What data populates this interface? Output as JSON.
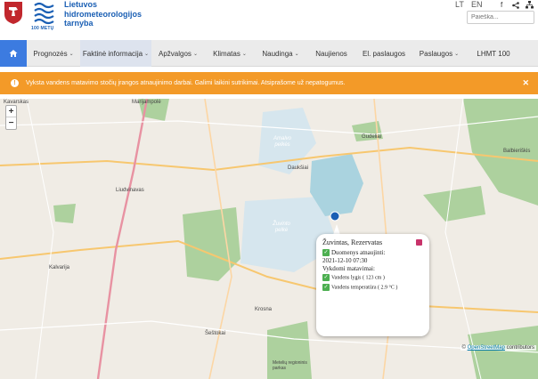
{
  "header": {
    "site_name_lines": [
      "Lietuvos",
      "hidrometeorologijos",
      "tarnyba"
    ],
    "anniversary": "100 METŲ",
    "lang_lt": "LT",
    "lang_en": "EN",
    "search_placeholder": "Paieška..."
  },
  "nav": {
    "items": [
      {
        "label": "Prognozės",
        "dropdown": true
      },
      {
        "label": "Faktinė informacija",
        "dropdown": true,
        "active": true
      },
      {
        "label": "Apžvalgos",
        "dropdown": true
      },
      {
        "label": "Klimatas",
        "dropdown": true
      },
      {
        "label": "Naudinga",
        "dropdown": true
      },
      {
        "label": "Naujienos",
        "dropdown": false
      },
      {
        "label": "El. paslaugos",
        "dropdown": false
      },
      {
        "label": "Paslaugos",
        "dropdown": true
      },
      {
        "label": "LHMT 100",
        "dropdown": false
      }
    ]
  },
  "alert": {
    "text": "Vyksta vandens matavimo stočių įrangos atnaujinimo darbai. Galimi laikini sutrikimai. Atsiprašome už nepatogumus.",
    "color": "#f39a28"
  },
  "map": {
    "towns": [
      "Marijampolė",
      "Liudvinavas",
      "Daukšiai",
      "Gudeliai",
      "Balbieriškis",
      "Kalvarija",
      "Krosna",
      "Šeštokai",
      "Metelių regioninis parkas",
      "Kavarskas"
    ],
    "lake_labels": [
      "Amalvo pelkės",
      "Žuvinto pelkė"
    ],
    "popup": {
      "title": "Žuvintas, Rezervatas",
      "updated_label": "Duomenys atnaujinti:",
      "updated_value": "2021-12-10 07:30",
      "measurements_label": "Vykdomi matavimai:",
      "measurements": [
        {
          "label": "Vandens lygis ( 123 cm )"
        },
        {
          "label": "Vandens temperatūra ( 2.9 °C )"
        }
      ]
    },
    "attribution_prefix": "©",
    "attribution_link": "OpenStreetMap",
    "attribution_suffix": "contributors"
  },
  "colors": {
    "nav_home": "#3c7be0",
    "accent_blue": "#1a5fb4",
    "map_base": "#f2efe9",
    "forest": "#add19e",
    "water": "#aad3df"
  }
}
